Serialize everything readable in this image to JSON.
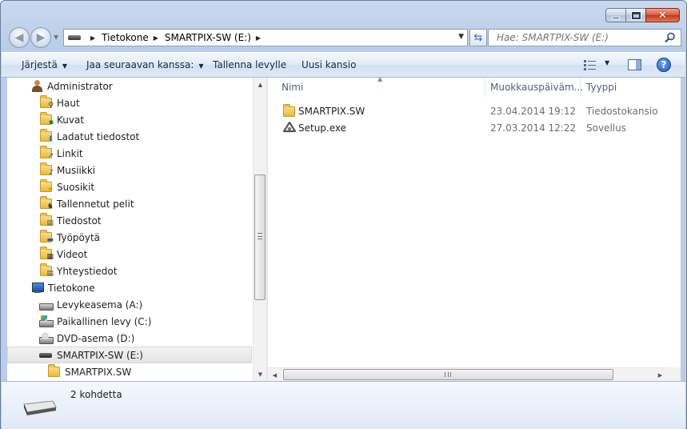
{
  "window": {
    "caption_buttons": [
      "minimize",
      "maximize",
      "close"
    ]
  },
  "address": {
    "crumbs": [
      "Tietokone",
      "SMARTPIX-SW (E:)"
    ],
    "search_placeholder": "Hae: SMARTPIX-SW (E:)"
  },
  "toolbar": {
    "organize": "Järjestä",
    "share": "Jaa seuraavan kanssa:",
    "burn": "Tallenna levylle",
    "new_folder": "Uusi kansio"
  },
  "nav_pane": {
    "items": [
      {
        "label": "Administrator",
        "icon": "user-folder-icon",
        "indent": 0
      },
      {
        "label": "Haut",
        "icon": "searches-folder-icon",
        "indent": 1
      },
      {
        "label": "Kuvat",
        "icon": "pictures-folder-icon",
        "indent": 1
      },
      {
        "label": "Ladatut tiedostot",
        "icon": "downloads-folder-icon",
        "indent": 1
      },
      {
        "label": "Linkit",
        "icon": "links-folder-icon",
        "indent": 1
      },
      {
        "label": "Musiikki",
        "icon": "music-folder-icon",
        "indent": 1
      },
      {
        "label": "Suosikit",
        "icon": "favorites-folder-icon",
        "indent": 1
      },
      {
        "label": "Tallennetut pelit",
        "icon": "saved-games-folder-icon",
        "indent": 1
      },
      {
        "label": "Tiedostot",
        "icon": "documents-folder-icon",
        "indent": 1
      },
      {
        "label": "Työpöytä",
        "icon": "desktop-folder-icon",
        "indent": 1
      },
      {
        "label": "Videot",
        "icon": "videos-folder-icon",
        "indent": 1
      },
      {
        "label": "Yhteystiedot",
        "icon": "contacts-folder-icon",
        "indent": 1
      },
      {
        "label": "Tietokone",
        "icon": "computer-icon",
        "indent": 0
      },
      {
        "label": "Levykeasema (A:)",
        "icon": "floppy-drive-icon",
        "indent": 1
      },
      {
        "label": "Paikallinen levy (C:)",
        "icon": "system-drive-icon",
        "indent": 1
      },
      {
        "label": "DVD-asema (D:)",
        "icon": "dvd-drive-icon",
        "indent": 1
      },
      {
        "label": "SMARTPIX-SW (E:)",
        "icon": "usb-drive-icon",
        "indent": 1,
        "selected": true
      },
      {
        "label": "SMARTPIX.SW",
        "icon": "folder-icon",
        "indent": 2
      }
    ]
  },
  "file_list": {
    "columns": [
      "Nimi",
      "Muokkauspäiväm...",
      "Tyyppi"
    ],
    "rows": [
      {
        "name": "SMARTPIX.SW",
        "modified": "23.04.2014 19:12",
        "type": "Tiedostokansio",
        "icon": "folder-icon"
      },
      {
        "name": "Setup.exe",
        "modified": "27.03.2014 12:22",
        "type": "Sovellus",
        "icon": "setup-app-icon"
      }
    ]
  },
  "details": {
    "count": "2 kohdetta"
  },
  "colors": {
    "frame": "#b9cde8",
    "selection": "#e4e4e4",
    "header_text": "#4c607a"
  }
}
